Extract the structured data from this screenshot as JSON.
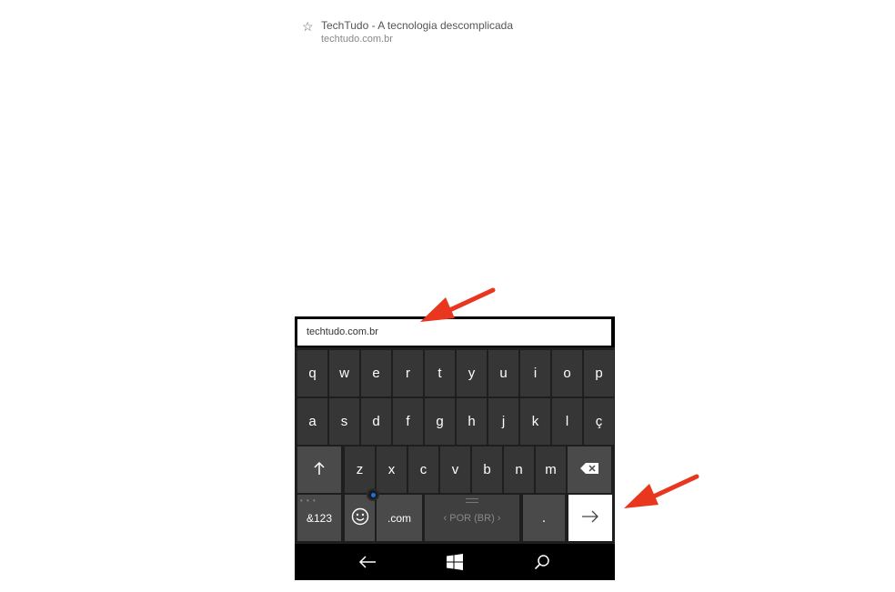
{
  "suggestion": {
    "star_icon": "star-icon",
    "title": "TechTudo - A tecnologia descomplicada",
    "url": "techtudo.com.br"
  },
  "address_bar": {
    "value": "techtudo.com.br"
  },
  "keyboard": {
    "row1": [
      "q",
      "w",
      "e",
      "r",
      "t",
      "y",
      "u",
      "i",
      "o",
      "p"
    ],
    "row2": [
      "a",
      "s",
      "d",
      "f",
      "g",
      "h",
      "j",
      "k",
      "l",
      "ç"
    ],
    "row3": [
      "z",
      "x",
      "c",
      "v",
      "b",
      "n",
      "m"
    ],
    "shift_icon": "shift-arrow-icon",
    "backspace_icon": "backspace-icon",
    "symbols_label": "&123",
    "emoji_icon": "emoji-icon",
    "dotcom_label": ".com",
    "language_label": "‹ POR (BR) ›",
    "period_label": ".",
    "enter_icon": "enter-arrow-icon"
  },
  "navbar": {
    "back_icon": "back-icon",
    "windows_icon": "windows-icon",
    "search_icon": "search-icon"
  },
  "colors": {
    "keyboard_bg": "#1e1e1e",
    "key": "#363636",
    "annotation_arrow": "#e8361f"
  }
}
